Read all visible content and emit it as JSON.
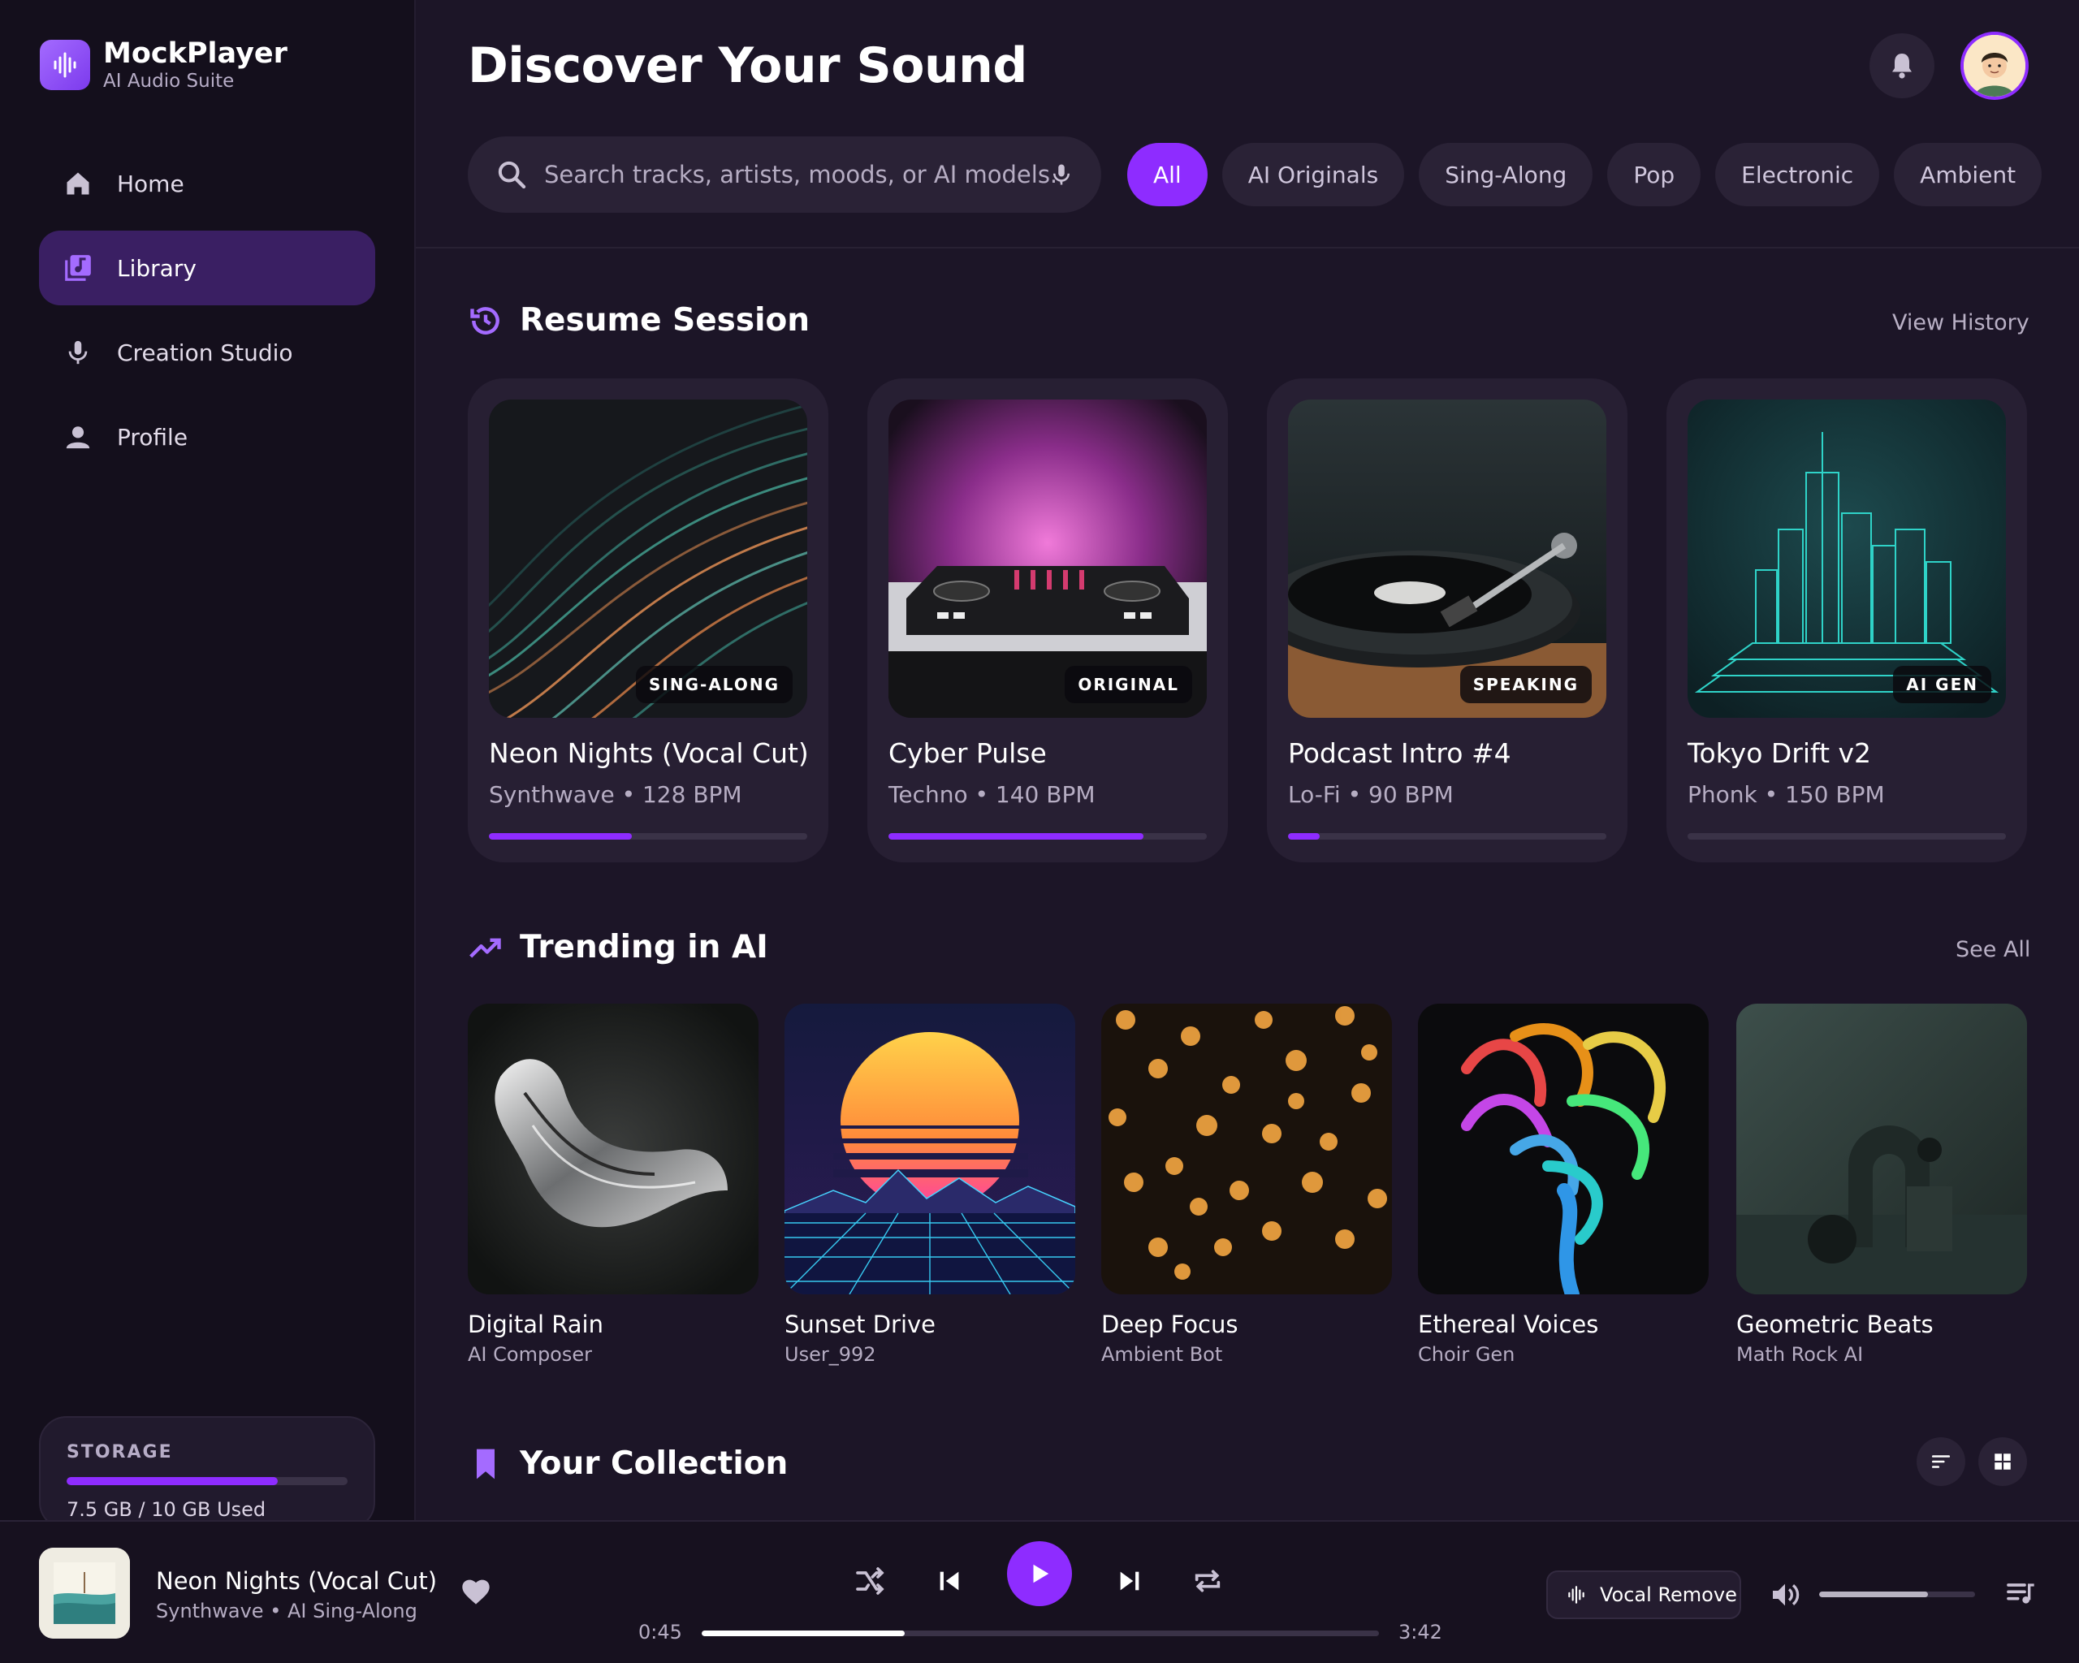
{
  "brand": {
    "name": "MockPlayer",
    "subtitle": "AI Audio Suite"
  },
  "sidebar": {
    "items": [
      {
        "label": "Home",
        "icon": "home-icon",
        "active": false
      },
      {
        "label": "Library",
        "icon": "library-icon",
        "active": true
      },
      {
        "label": "Creation Studio",
        "icon": "mic-icon",
        "active": false
      },
      {
        "label": "Profile",
        "icon": "user-icon",
        "active": false
      }
    ],
    "storage": {
      "label": "STORAGE",
      "used_fraction": 0.75,
      "text": "7.5 GB / 10 GB Used"
    }
  },
  "header": {
    "title": "Discover Your Sound"
  },
  "search": {
    "placeholder": "Search tracks, artists, moods, or AI models..."
  },
  "filters": [
    "All",
    "AI Originals",
    "Sing-Along",
    "Pop",
    "Electronic",
    "Ambient"
  ],
  "resume": {
    "title": "Resume Session",
    "link": "View History",
    "cards": [
      {
        "title": "Neon Nights (Vocal Cut)",
        "sub": "Synthwave • 128 BPM",
        "badge": "SING-ALONG",
        "progress": 0.45
      },
      {
        "title": "Cyber Pulse",
        "sub": "Techno • 140 BPM",
        "badge": "ORIGINAL",
        "progress": 0.8
      },
      {
        "title": "Podcast Intro #4",
        "sub": "Lo-Fi • 90 BPM",
        "badge": "SPEAKING",
        "progress": 0.1
      },
      {
        "title": "Tokyo Drift v2",
        "sub": "Phonk • 150 BPM",
        "badge": "AI GEN",
        "progress": 0.0
      }
    ]
  },
  "trending": {
    "title": "Trending in AI",
    "link": "See All",
    "cards": [
      {
        "title": "Digital Rain",
        "sub": "AI Composer"
      },
      {
        "title": "Sunset Drive",
        "sub": "User_992"
      },
      {
        "title": "Deep Focus",
        "sub": "Ambient Bot"
      },
      {
        "title": "Ethereal Voices",
        "sub": "Choir Gen"
      },
      {
        "title": "Geometric Beats",
        "sub": "Math Rock AI"
      }
    ]
  },
  "collection": {
    "title": "Your Collection"
  },
  "player": {
    "title": "Neon Nights (Vocal Cut)",
    "sub": "Synthwave • AI Sing-Along",
    "current_time": "0:45",
    "total_time": "3:42",
    "progress": 0.3,
    "vocal_label": "Vocal Remove",
    "volume": 0.7
  },
  "colors": {
    "accent": "#8e2cff",
    "background": "#1c1527",
    "sidebar": "#140f1c",
    "card": "#271f33"
  }
}
